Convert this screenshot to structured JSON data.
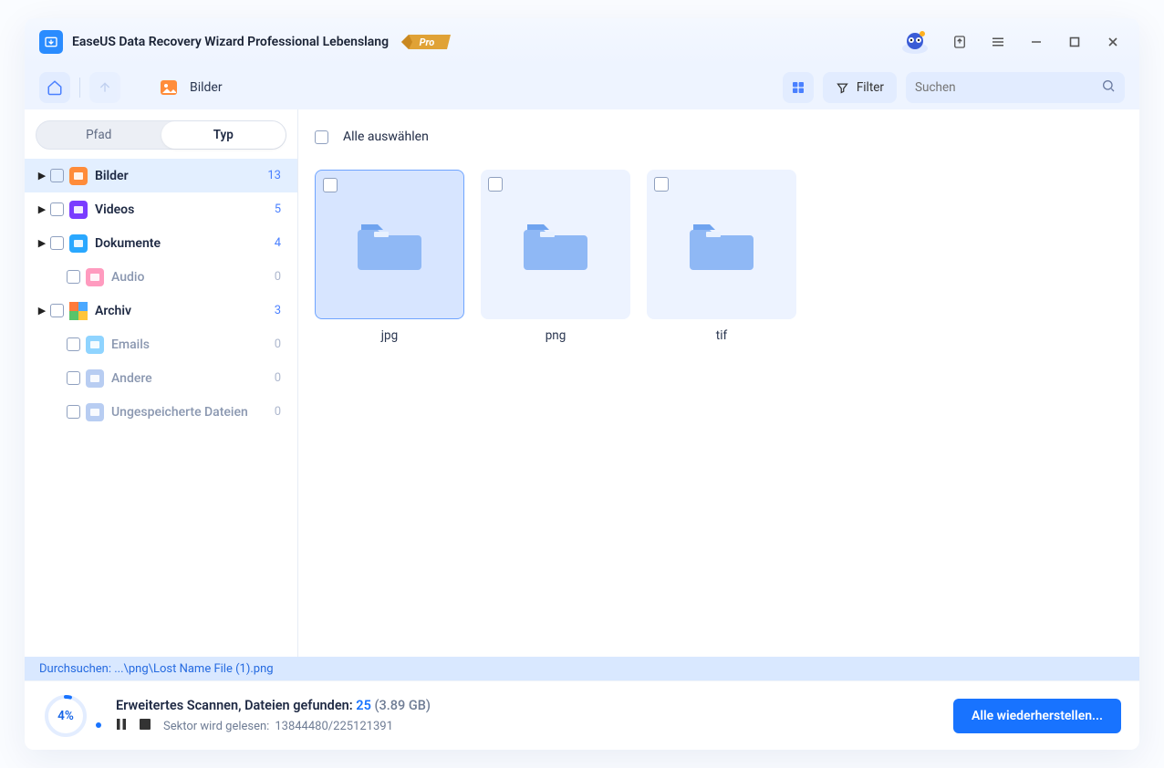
{
  "app": {
    "title": "EaseUS Data Recovery Wizard Professional Lebenslang"
  },
  "toolbar": {
    "breadcrumb_label": "Bilder",
    "filter_label": "Filter",
    "search_placeholder": "Suchen"
  },
  "sidebar": {
    "tabs": {
      "pfad": "Pfad",
      "typ": "Typ"
    },
    "items": [
      {
        "label": "Bilder",
        "count": "13",
        "icon_bg": "#ff8c3a",
        "caret": true,
        "muted": false,
        "selected": true
      },
      {
        "label": "Videos",
        "count": "5",
        "icon_bg": "#7a3cff",
        "caret": true,
        "muted": false,
        "selected": false
      },
      {
        "label": "Dokumente",
        "count": "4",
        "icon_bg": "#2aa8ff",
        "caret": true,
        "muted": false,
        "selected": false
      },
      {
        "label": "Audio",
        "count": "0",
        "icon_bg": "#ff9bbf",
        "caret": false,
        "muted": true,
        "selected": false
      },
      {
        "label": "Archiv",
        "count": "3",
        "icon_bg": "#ff6a4a",
        "caret": true,
        "muted": false,
        "selected": false,
        "multi": true
      },
      {
        "label": "Emails",
        "count": "0",
        "icon_bg": "#8fd4ff",
        "caret": false,
        "muted": true,
        "selected": false
      },
      {
        "label": "Andere",
        "count": "0",
        "icon_bg": "#b8cdf2",
        "caret": false,
        "muted": true,
        "selected": false
      },
      {
        "label": "Ungespeicherte Dateien",
        "count": "0",
        "icon_bg": "#b8cdf2",
        "caret": false,
        "muted": true,
        "selected": false
      }
    ]
  },
  "main": {
    "select_all": "Alle auswählen",
    "tiles": [
      {
        "label": "jpg",
        "selected": true
      },
      {
        "label": "png",
        "selected": false
      },
      {
        "label": "tif",
        "selected": false
      }
    ]
  },
  "scan_path": "Durchsuchen: ...\\png\\Lost Name File (1).png",
  "status": {
    "percent": "4%",
    "headline": "Erweitertes Scannen, Dateien gefunden:",
    "count": "25",
    "size": "(3.89 GB)",
    "sector_label": "Sektor wird gelesen:",
    "sector_value": "13844480/225121391",
    "recover_btn": "Alle wiederherstellen..."
  }
}
